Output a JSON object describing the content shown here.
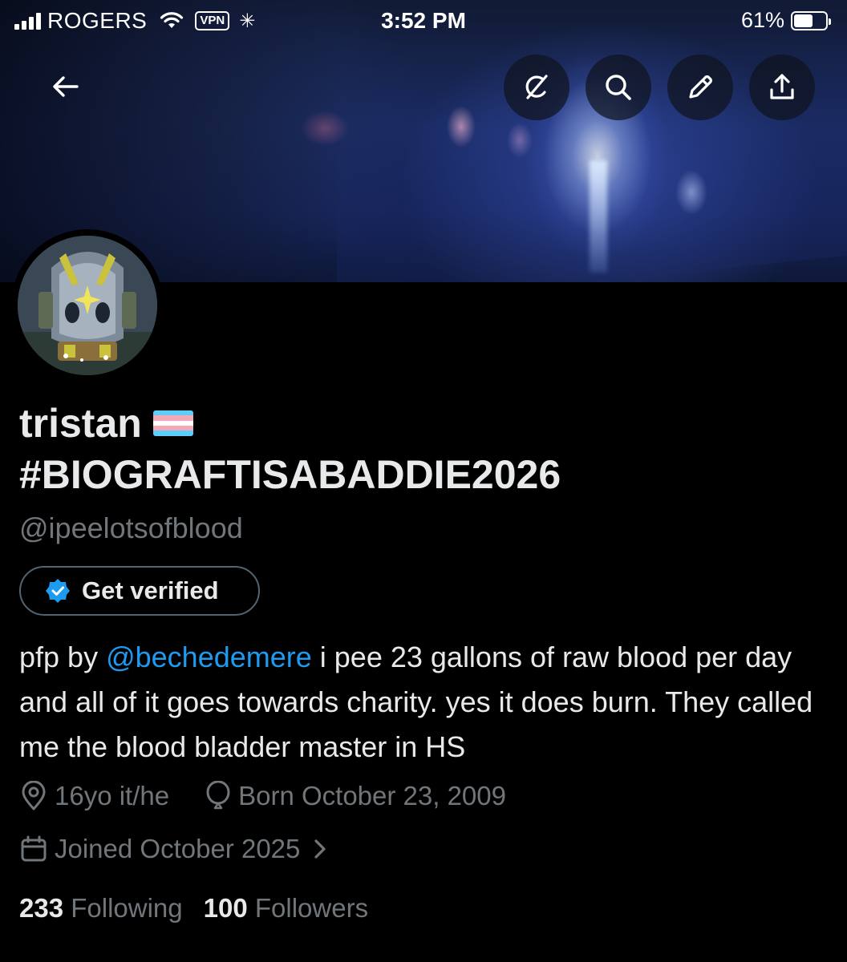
{
  "status_bar": {
    "carrier": "ROGERS",
    "vpn_label": "VPN",
    "time": "3:52 PM",
    "battery_percent": "61%",
    "battery_level": 0.61
  },
  "header": {
    "back_icon": "arrow-left-icon",
    "actions": [
      {
        "icon": "grok-icon",
        "name": "grok-button"
      },
      {
        "icon": "search-icon",
        "name": "search-button"
      },
      {
        "icon": "edit-icon",
        "name": "edit-button"
      },
      {
        "icon": "share-icon",
        "name": "share-button"
      }
    ]
  },
  "profile": {
    "display_name_line1": "tristan",
    "display_name_line2": "#BIOGRAFTISABADDIE2026",
    "flag_emoji": "transgender-flag",
    "handle": "@ipeelotsofblood",
    "verify_label": "Get verified",
    "bio_prefix": "pfp by ",
    "bio_mention": "@bechedemere",
    "bio_rest": " i pee 23 gallons of raw blood per day and all of it goes towards charity. yes it does burn. They called me the blood bladder master in HS",
    "location": "16yo it/he",
    "birthday": "Born October 23, 2009",
    "joined": "Joined October 2025",
    "following_count": "233",
    "following_label": "Following",
    "followers_count": "100",
    "followers_label": "Followers"
  },
  "colors": {
    "background": "#000000",
    "text_primary": "#e7e9ea",
    "text_secondary": "#71767b",
    "link": "#1d9bf0",
    "verified_badge": "#1d9bf0"
  }
}
